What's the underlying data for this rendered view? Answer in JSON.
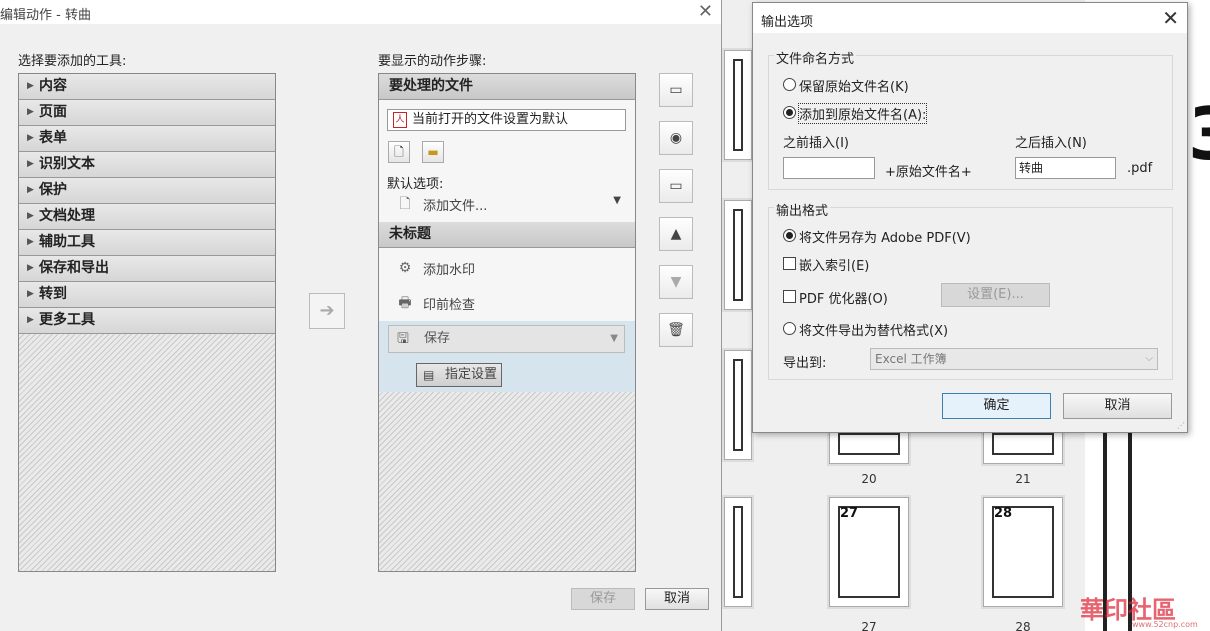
{
  "left_dialog": {
    "title": "编辑动作 - 转曲",
    "close": "✕",
    "tools_label": "选择要添加的工具:",
    "tools": [
      "内容",
      "页面",
      "表单",
      "识别文本",
      "保护",
      "文档处理",
      "辅助工具",
      "保存和导出",
      "转到",
      "更多工具"
    ],
    "steps_label": "要显示的动作步骤:",
    "section1": {
      "title": "要处理的文件",
      "file_field": "当前打开的文件设置为默认",
      "default_label": "默认选项:",
      "add_file": "添加文件..."
    },
    "section2": {
      "title": "未标题",
      "steps": [
        "添加水印",
        "印前检查",
        "保存"
      ],
      "specify": "指定设置"
    },
    "save_button": "保存",
    "cancel_button": "取消"
  },
  "right_dialog": {
    "title": "输出选项",
    "close": "✕",
    "naming_group": "文件命名方式",
    "keep_name": "保留原始文件名(K)",
    "add_to_name": "添加到原始文件名(A):",
    "insert_before_label": "之前插入(I)",
    "insert_before_value": "",
    "original_name": "+原始文件名+",
    "insert_after_label": "之后插入(N)",
    "insert_after_value": "转曲",
    "ext": ".pdf",
    "format_group": "输出格式",
    "save_as_pdf": "将文件另存为 Adobe PDF(V)",
    "embed_index": "嵌入索引(E)",
    "pdf_optimizer": "PDF 优化器(O)",
    "settings_button": "设置(E)...",
    "export_alt": "将文件导出为替代格式(X)",
    "export_to_label": "导出到:",
    "export_to_value": "Excel 工作簿",
    "ok_button": "确定",
    "cancel_button": "取消"
  },
  "background": {
    "big_number": "3",
    "pages": [
      {
        "label": "20"
      },
      {
        "label": "21"
      },
      {
        "number": "27",
        "label": "27"
      },
      {
        "number": "28",
        "label": "28"
      }
    ],
    "watermark": "華印社區",
    "watermark_url": "www.52cnp.com"
  }
}
